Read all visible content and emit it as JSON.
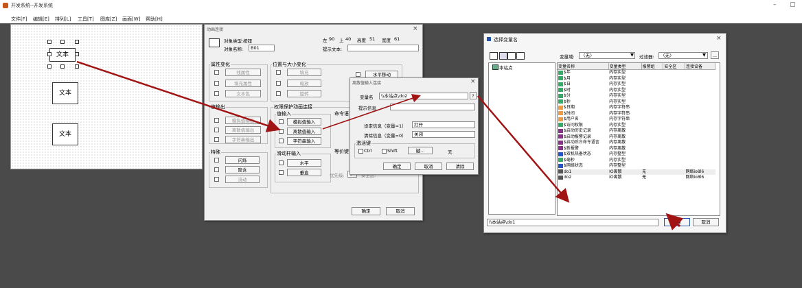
{
  "app": {
    "title": "开发系统--开发系统",
    "minimize_glyph": "–",
    "restore_glyph": "▢"
  },
  "menu": [
    "文件[F]",
    "编辑[E]",
    "排列[L]",
    "工具[T]",
    "图库[Z]",
    "画面[W]",
    "帮助[H]"
  ],
  "canvas": {
    "objects": [
      "文本",
      "文本",
      "文本"
    ]
  },
  "anim_dialog": {
    "title": "动画连接",
    "obj_type_label": "对象类型:",
    "obj_type_value": "按钮",
    "obj_name_label": "对象名称:",
    "obj_name_value": "B01",
    "left_label": "左",
    "left_value": "90",
    "top_label": "上",
    "top_value": "40",
    "height_label": "高度",
    "height_value": "51",
    "width_label": "宽度",
    "width_value": "61",
    "hint_label": "提示文本:",
    "groups": {
      "attr": {
        "label": "属性变化",
        "buttons": [
          "线属性",
          "填充属性",
          "文本色"
        ]
      },
      "pos": {
        "label": "位置与大小变化",
        "buttons": [
          "填充",
          "缩放",
          "旋转"
        ],
        "right_buttons": [
          "水平移动"
        ]
      },
      "value_out": {
        "label": "值输出",
        "buttons": [
          "模拟值输出",
          "离散值输出",
          "字符串输出"
        ]
      },
      "perm": {
        "label": "权限保护动画连接"
      },
      "value_in": {
        "label": "值输入",
        "buttons": [
          "模拟值输入",
          "离散值输入",
          "字符串输入"
        ]
      },
      "cmd": {
        "label": "命令语言"
      },
      "special": {
        "label": "特殊",
        "buttons": [
          "闪烁",
          "隐含",
          "流动"
        ]
      },
      "slider": {
        "label": "滑动杆输入",
        "buttons": [
          "水平",
          "垂直"
        ]
      },
      "equiv": {
        "label": "等价键"
      },
      "priority": {
        "label": "优先级:",
        "value": "0",
        "security_label": "安全区:"
      }
    },
    "ok": "确定",
    "cancel": "取消"
  },
  "discrete_dialog": {
    "title": "离散值输入连接",
    "var_label": "变量名",
    "var_value": "\\\\本站点\\do2",
    "browse": "?",
    "hint_label": "提示信息",
    "set_label": "设定信息（变量=1）",
    "set_value": "打开",
    "clear_label": "清除信息（变量=0）",
    "clear_value": "关闭",
    "hotkey_label": "激活键",
    "ctrl": "Ctrl",
    "shift": "Shift",
    "key_btn": "键...",
    "key_value": "无",
    "ok": "确定",
    "cancel": "取消",
    "clear": "清除"
  },
  "var_dialog": {
    "title": "选择变量名",
    "domain_label": "变量域:",
    "domain_value": "〈无〉",
    "filter_label": "过滤器:",
    "filter_value": "〈无〉",
    "more": "...",
    "tree_root": "本站点",
    "columns": [
      "变量名称",
      "变量类型",
      "报警组",
      "安全区",
      "连接设备"
    ],
    "rows": [
      {
        "name": "$年",
        "type": "内存实型",
        "icon": "grid-icon"
      },
      {
        "name": "$月",
        "type": "内存实型",
        "icon": "grid-icon"
      },
      {
        "name": "$日",
        "type": "内存实型",
        "icon": "grid-icon"
      },
      {
        "name": "$时",
        "type": "内存实型",
        "icon": "grid-icon"
      },
      {
        "name": "$分",
        "type": "内存实型",
        "icon": "grid-icon"
      },
      {
        "name": "$秒",
        "type": "内存实型",
        "icon": "grid-icon"
      },
      {
        "name": "$日期",
        "type": "内存字符串",
        "icon": "abc-icon"
      },
      {
        "name": "$时间",
        "type": "内存字符串",
        "icon": "abc-icon"
      },
      {
        "name": "$用户名",
        "type": "内存字符串",
        "icon": "abc-icon"
      },
      {
        "name": "$访问权限",
        "type": "内存实型",
        "icon": "grid-icon"
      },
      {
        "name": "$启动历史记录",
        "type": "内存离散",
        "icon": "bool-icon"
      },
      {
        "name": "$启动报警记录",
        "type": "内存离散",
        "icon": "bool-icon"
      },
      {
        "name": "$启动后台命令语言",
        "type": "内存离散",
        "icon": "bool-icon"
      },
      {
        "name": "$新报警",
        "type": "内存离散",
        "icon": "bool-icon"
      },
      {
        "name": "$双机热备状态",
        "type": "内存整型",
        "icon": "int-icon"
      },
      {
        "name": "$毫秒",
        "type": "内存实型",
        "icon": "grid-icon"
      },
      {
        "name": "$网络状态",
        "type": "内存整型",
        "icon": "int-icon"
      },
      {
        "name": "do1",
        "type": "IO离散",
        "alarm": "无",
        "device": "网络io8l6",
        "icon": "io-icon"
      },
      {
        "name": "do2",
        "type": "IO离散",
        "alarm": "无",
        "device": "网络io8l6",
        "icon": "io-icon"
      }
    ],
    "path": "\\\\本站点\\do1",
    "ok": "确定",
    "cancel": "取消"
  },
  "colors": {
    "arrow": "#a01414",
    "desktop": "#4a4a4a"
  }
}
